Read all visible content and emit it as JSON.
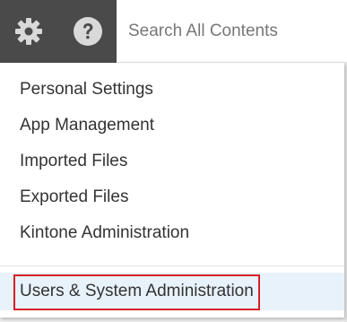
{
  "header": {
    "settings_icon": "gear-icon",
    "help_icon": "question-circle-icon",
    "search": {
      "placeholder": "Search All Contents",
      "value": ""
    },
    "colors": {
      "icon_bar": "#4a4a4a",
      "icon_fill": "#d9d9d9"
    }
  },
  "menu": {
    "items": [
      {
        "label": "Personal Settings"
      },
      {
        "label": "App Management"
      },
      {
        "label": "Imported Files"
      },
      {
        "label": "Exported Files"
      },
      {
        "label": "Kintone Administration"
      }
    ],
    "highlighted_item": {
      "label": "Users & System Administration",
      "highlight_color": "#d6202a",
      "hover_bg": "#e8f2fb"
    }
  }
}
